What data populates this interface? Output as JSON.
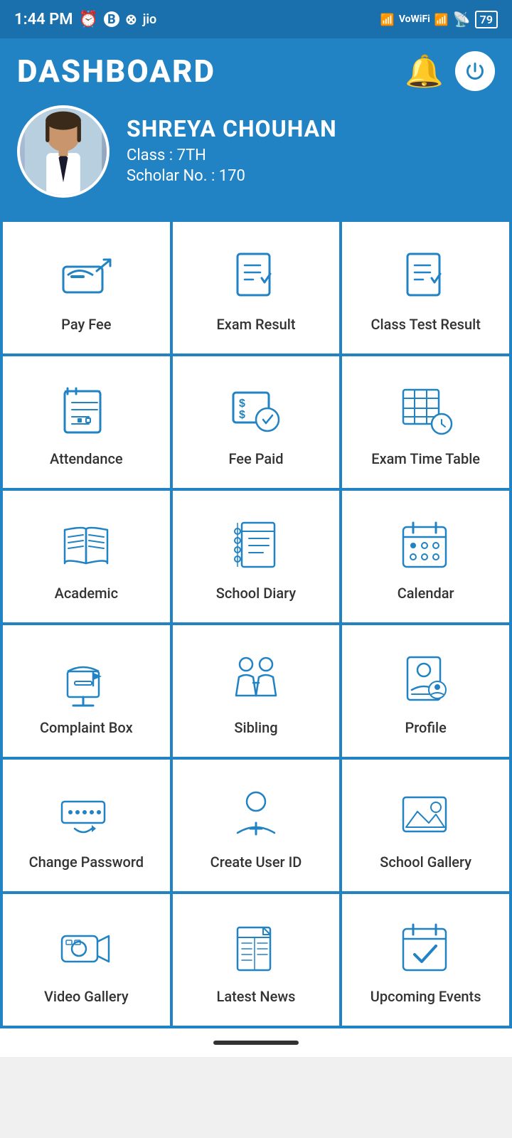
{
  "statusBar": {
    "time": "1:44 PM",
    "battery": "79"
  },
  "header": {
    "title": "DASHBOARD",
    "bellLabel": "Notifications",
    "powerLabel": "Power"
  },
  "profile": {
    "name": "SHREYA  CHOUHAN",
    "classLabel": "Class : 7TH",
    "scholarLabel": "Scholar No. : 170",
    "avatarAlt": "Shreya Chouhan"
  },
  "grid": {
    "items": [
      {
        "id": "pay-fee",
        "label": "Pay Fee",
        "icon": "pay-fee-icon"
      },
      {
        "id": "exam-result",
        "label": "Exam Result",
        "icon": "exam-result-icon"
      },
      {
        "id": "class-test-result",
        "label": "Class Test Result",
        "icon": "class-test-icon"
      },
      {
        "id": "attendance",
        "label": "Attendance",
        "icon": "attendance-icon"
      },
      {
        "id": "fee-paid",
        "label": "Fee Paid",
        "icon": "fee-paid-icon"
      },
      {
        "id": "exam-time-table",
        "label": "Exam Time Table",
        "icon": "timetable-icon"
      },
      {
        "id": "academic",
        "label": "Academic",
        "icon": "academic-icon"
      },
      {
        "id": "school-diary",
        "label": "School Diary",
        "icon": "diary-icon"
      },
      {
        "id": "calendar",
        "label": "Calendar",
        "icon": "calendar-icon"
      },
      {
        "id": "complaint-box",
        "label": "Complaint Box",
        "icon": "complaint-icon"
      },
      {
        "id": "sibling",
        "label": "Sibling",
        "icon": "sibling-icon"
      },
      {
        "id": "profile",
        "label": "Profile",
        "icon": "profile-icon"
      },
      {
        "id": "change-password",
        "label": "Change Password",
        "icon": "password-icon"
      },
      {
        "id": "create-user-id",
        "label": "Create User ID",
        "icon": "create-user-icon"
      },
      {
        "id": "school-gallery",
        "label": "School Gallery",
        "icon": "gallery-icon"
      },
      {
        "id": "video-gallery",
        "label": "Video Gallery",
        "icon": "video-icon"
      },
      {
        "id": "latest-news",
        "label": "Latest News",
        "icon": "news-icon"
      },
      {
        "id": "upcoming-events",
        "label": "Upcoming Events",
        "icon": "events-icon"
      }
    ]
  }
}
